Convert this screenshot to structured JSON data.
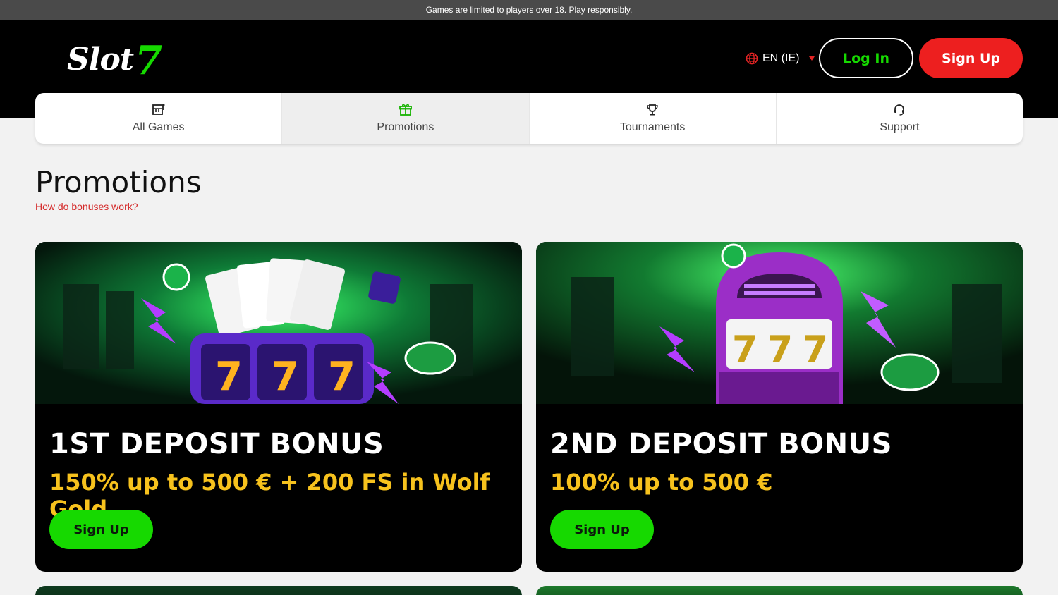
{
  "notice": "Games are limited to players over 18. Play responsibly.",
  "header": {
    "logo_text": "Slot",
    "logo_seven": "7",
    "language": "EN (IE)",
    "login_label": "Log In",
    "signup_label": "Sign Up"
  },
  "nav": {
    "items": [
      {
        "label": "All Games",
        "icon": "games-icon"
      },
      {
        "label": "Promotions",
        "icon": "gift-icon",
        "active": true
      },
      {
        "label": "Tournaments",
        "icon": "trophy-icon"
      },
      {
        "label": "Support",
        "icon": "headset-icon"
      }
    ]
  },
  "page": {
    "title": "Promotions",
    "help_link": "How do bonuses work?"
  },
  "promotions": [
    {
      "title": "1ST DEPOSIT BONUS",
      "offer": "150% up to 500 € + 200 FS in Wolf Gold",
      "button": "Sign Up",
      "image": "slot-machine-cards-banner"
    },
    {
      "title": "2ND DEPOSIT BONUS",
      "offer": "100% up to 500 €",
      "button": "Sign Up",
      "image": "jukebox-slot-banner"
    }
  ],
  "colors": {
    "brand_green": "#16d900",
    "signup_red": "#ed1f1f",
    "offer_yellow": "#f7c21d",
    "header_bg": "#000000"
  }
}
